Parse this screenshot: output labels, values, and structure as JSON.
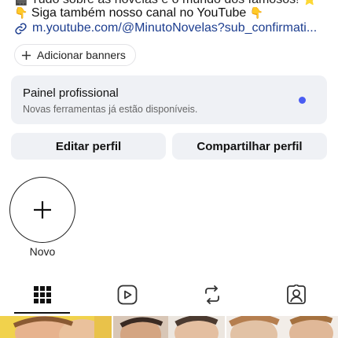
{
  "bio": {
    "line1": "Tudo sobre as novelas e o mundo dos famosos!",
    "line2": "Siga também nosso canal no YouTube",
    "link": "m.youtube.com/@MinutoNovelas?sub_confirmati..."
  },
  "add_banners": {
    "label": "Adicionar banners"
  },
  "professional_panel": {
    "title": "Painel profissional",
    "subtitle": "Novas ferramentas já estão disponíveis.",
    "dot_color": "#4a5df3"
  },
  "buttons": {
    "edit": "Editar perfil",
    "share": "Compartilhar perfil"
  },
  "highlight": {
    "new_label": "Novo"
  },
  "tabs": [
    {
      "name": "grid-icon",
      "active": true
    },
    {
      "name": "reels-icon",
      "active": false
    },
    {
      "name": "reposts-icon",
      "active": false
    },
    {
      "name": "tagged-icon",
      "active": false
    }
  ],
  "colors": {
    "link": "#1c3d8f",
    "panel_bg": "#eff1f5",
    "accent_dot": "#4a5df3"
  }
}
